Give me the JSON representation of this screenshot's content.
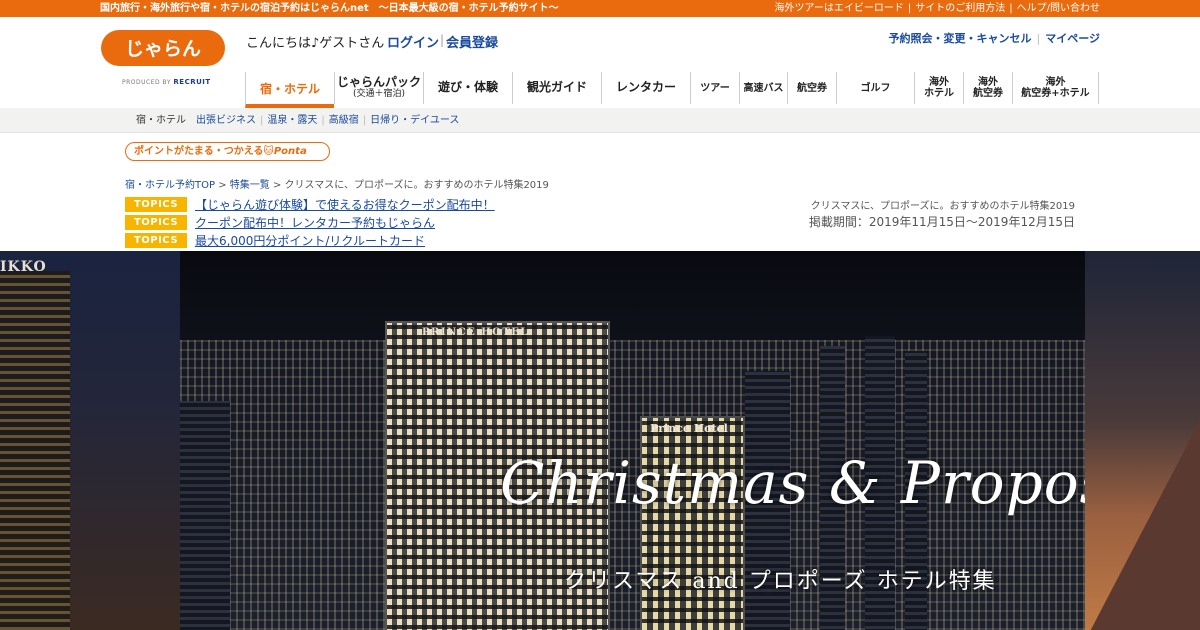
{
  "topbar": {
    "tagline": "国内旅行・海外旅行や宿・ホテルの宿泊予約はじゃらんnet　～日本最大級の宿・ホテル予約サイト～",
    "links": [
      "海外ツアーはエイビーロード",
      "サイトのご利用方法",
      "ヘルプ/問い合わせ"
    ]
  },
  "header": {
    "logo_text": "じゃらん",
    "produced_by": "PRODUCED BY",
    "recruit": "RECRUIT",
    "greeting": "こんにちは♪ゲストさん",
    "login": "ログイン",
    "register": "会員登録",
    "right_links": [
      "予約照会・変更・キャンセル",
      "マイページ"
    ]
  },
  "mainnav": {
    "items": [
      {
        "label": "宿・ホテル",
        "sub": ""
      },
      {
        "label": "じゃらんパック",
        "sub": "(交通＋宿泊)"
      },
      {
        "label": "遊び・体験",
        "sub": ""
      },
      {
        "label": "観光ガイド",
        "sub": ""
      },
      {
        "label": "レンタカー",
        "sub": ""
      },
      {
        "label": "ツアー",
        "sub": ""
      },
      {
        "label": "高速バス",
        "sub": ""
      },
      {
        "label": "航空券",
        "sub": ""
      },
      {
        "label": "ゴルフ",
        "sub": ""
      },
      {
        "label": "海外",
        "sub": "ホテル"
      },
      {
        "label": "海外",
        "sub": "航空券"
      },
      {
        "label": "海外",
        "sub": "航空券+ホテル"
      }
    ]
  },
  "subnav": {
    "current": "宿・ホテル",
    "links": [
      "出張ビジネス",
      "温泉・露天",
      "高級宿",
      "日帰り・デイユース"
    ]
  },
  "ponta": {
    "text": "ポイントがたまる・つかえる",
    "brand": "Ponta"
  },
  "breadcrumb": {
    "items": [
      "宿・ホテル予約TOP",
      "特集一覧",
      "クリスマスに、プロポーズに。おすすめのホテル特集2019"
    ],
    "sep": ">"
  },
  "topics": {
    "badge": "TOPICS",
    "items": [
      "【じゃらん遊び体験】で使えるお得なクーポン配布中！",
      "クーポン配布中！レンタカー予約もじゃらん",
      "最大6,000円分ポイント/リクルートカード"
    ]
  },
  "feature": {
    "title": "クリスマスに、プロポーズに。おすすめのホテル特集2019",
    "period": "掲載期間：2019年11月15日～2019年12月15日"
  },
  "hero": {
    "script_title": "Christmas & Propose",
    "subtitle": "クリスマス and プロポーズ ホテル特集",
    "sign_left": "IKKO",
    "sign_tower": "PRINCE HOTEL",
    "sign_tower2": "Prince Hotel"
  },
  "colors": {
    "brand_orange": "#ea6b0e",
    "link_blue": "#1a4a9e",
    "topics_yellow": "#f7b500"
  }
}
